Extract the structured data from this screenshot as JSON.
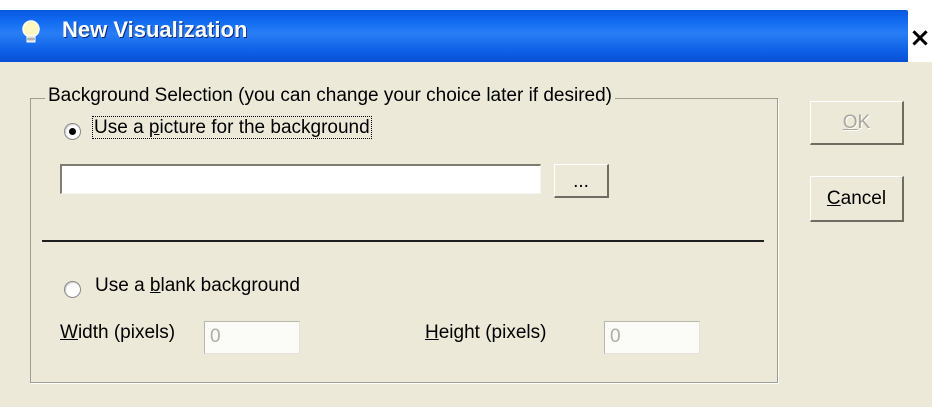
{
  "window": {
    "title": "New Visualization",
    "close_label": "×"
  },
  "group": {
    "legend": "Background Selection (you can change your choice later if desired)"
  },
  "options": {
    "picture": {
      "prefix": "Use a ",
      "accel": "p",
      "suffix": "icture for the background",
      "selected": true
    },
    "blank": {
      "prefix": "Use a ",
      "accel": "b",
      "suffix": "lank background",
      "selected": false
    }
  },
  "picture_path": {
    "value": "",
    "browse_label": "..."
  },
  "width": {
    "label_accel": "W",
    "label_rest": "idth (pixels)",
    "value": "0"
  },
  "height": {
    "label_accel": "H",
    "label_rest": "eight (pixels)",
    "value": "0"
  },
  "buttons": {
    "ok_accel": "O",
    "ok_rest": "K",
    "ok_enabled": false,
    "cancel_accel": "C",
    "cancel_rest": "ancel"
  },
  "colors": {
    "titlebar": "#0a57e0",
    "dialog_bg": "#ece9d8"
  },
  "icons": {
    "title": "lightbulb-icon",
    "close": "close-icon"
  }
}
